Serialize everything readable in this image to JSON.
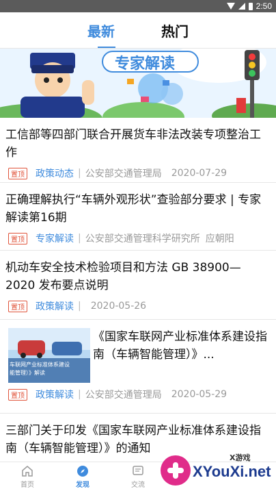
{
  "status_bar": {
    "time": "2:50"
  },
  "tabs": [
    {
      "label": "最新"
    },
    {
      "label": "热门"
    }
  ],
  "banner": {
    "caption": "专家解读"
  },
  "articles": [
    {
      "title": "工信部等四部门联合开展货车非法改装专项整治工作",
      "tag": "置顶",
      "category": "政策动态",
      "source": "公安部交通管理局",
      "date": "2020-07-29"
    },
    {
      "title": "正确理解执行“车辆外观形状”查验部分要求 | 专家解读第16期",
      "tag": "置顶",
      "category": "专家解读",
      "source": "公安部交通管理科学研究所",
      "author": "应朝阳"
    },
    {
      "title": "机动车安全技术检验项目和方法 GB 38900—2020 发布要点说明",
      "tag": "置顶",
      "category": "政策解读",
      "date": "2020-05-26"
    },
    {
      "title": "《国家车联网产业标准体系建设指南（车辆智能管理）》...",
      "thumb_caption_1": "车联网产业标准体系建设",
      "thumb_caption_2": "能管理）》解读",
      "tag": "置顶",
      "category": "政策解读",
      "source": "公安部交通管理局",
      "date": "2020-05-29"
    },
    {
      "title": "三部门关于印发《国家车联网产业标准体系建设指南（车辆智能管理）》的通知"
    }
  ],
  "bottom_nav": [
    {
      "label": "首页"
    },
    {
      "label": "发现"
    },
    {
      "label": "交流"
    }
  ],
  "watermark": {
    "brand": "XYouXi.net",
    "small": "X游戏"
  },
  "colors": {
    "accent": "#3f8bdd",
    "tag": "#e0533a",
    "status_bar": "#5b5b5b"
  }
}
